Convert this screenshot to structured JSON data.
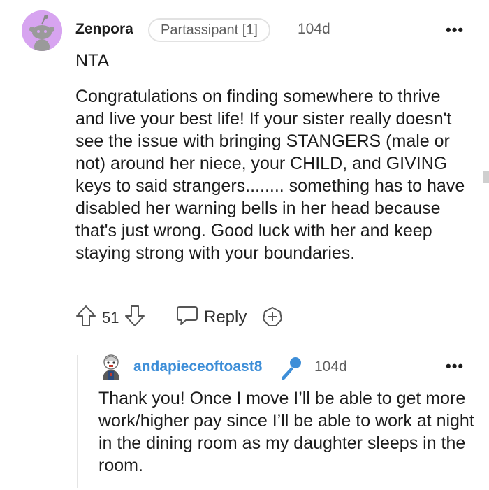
{
  "comment": {
    "avatar_icon": "snoo-avatar-icon",
    "username": "Zenpora",
    "flair": "Partassipant [1]",
    "time": "104d",
    "more": "•••",
    "title_line": "NTA",
    "body": "Congratulations on finding somewhere to thrive and live your best life! If your sister really doesn't see the issue with bringing STANGERS (male or not) around her niece, your CHILD, and GIVING keys to said strangers........ something has to have disabled her warning bells in her head because that's just wrong. Good luck with her and keep staying strong with your boundaries.",
    "votes": "51",
    "reply_label": "Reply"
  },
  "reply": {
    "avatar_icon": "custom-avatar-icon",
    "username": "andapieceoftoast8",
    "badge_icon": "microphone-icon",
    "time": "104d",
    "more": "•••",
    "body": "Thank you! Once I move I’ll be able to get more work/higher pay since I’ll be able to work at night in the dining room as my daughter sleeps in the room."
  },
  "colors": {
    "username_link": "#3d8ed8",
    "avatar_bg": "#d7a4f0",
    "muted_text": "#5e5e5e"
  }
}
